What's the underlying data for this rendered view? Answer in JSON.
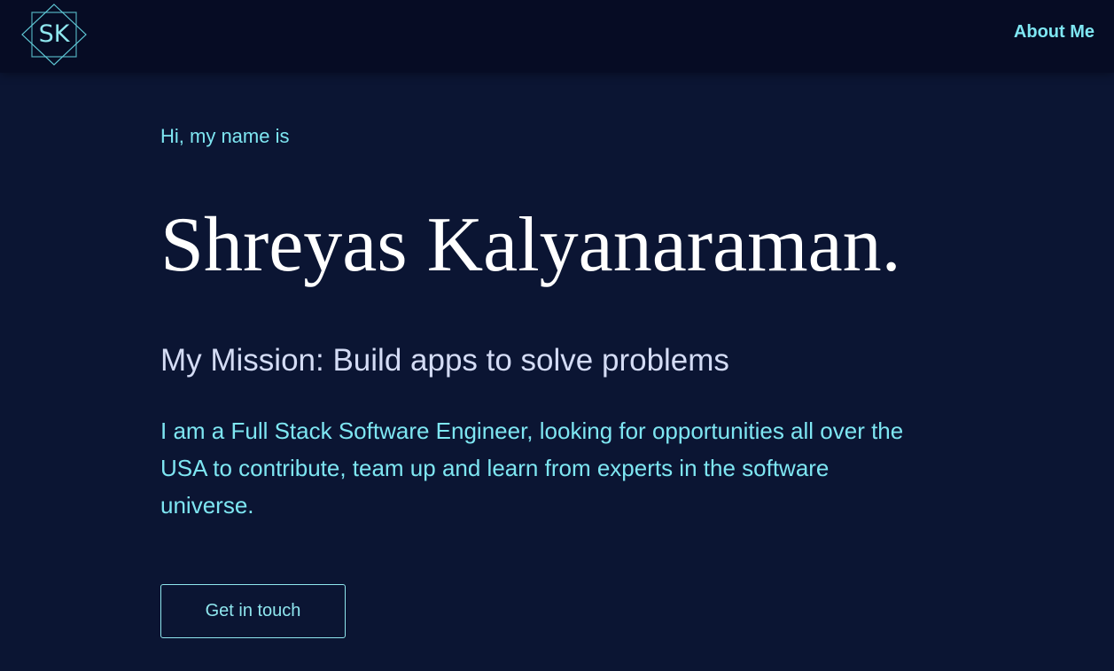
{
  "navbar": {
    "logo_text": "SK",
    "links": [
      {
        "label": "About Me"
      }
    ]
  },
  "hero": {
    "greeting": "Hi, my name is",
    "name": "Shreyas Kalyanaraman.",
    "mission": "My Mission: Build apps to solve problems",
    "description": "I am a Full Stack Software Engineer, looking for opportunities all over the USA to contribute, team up and learn from experts in the software universe.",
    "cta_label": "Get in touch"
  },
  "colors": {
    "background": "#0b1533",
    "navbar": "#060c24",
    "accent": "#7ee6f2",
    "heading": "#ffffff",
    "subheading": "#d4dcf5"
  }
}
